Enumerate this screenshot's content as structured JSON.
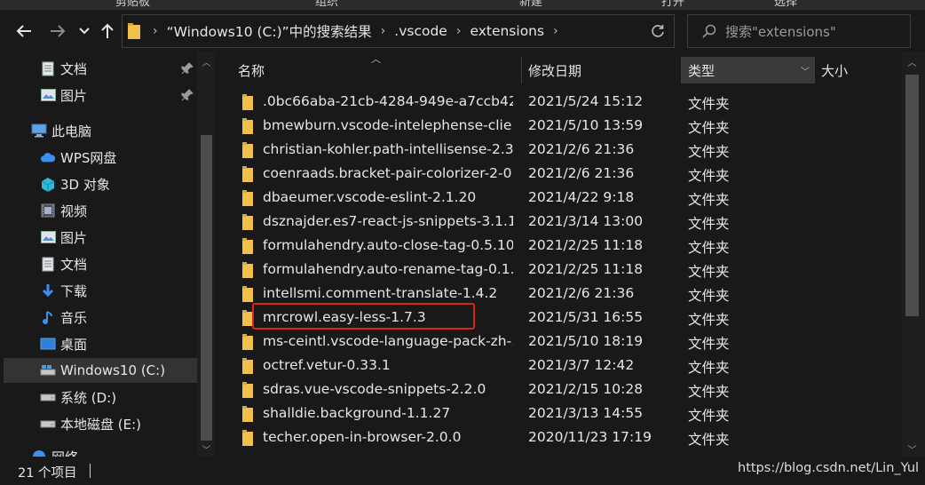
{
  "ribbon": {
    "labels": [
      "剪贴板",
      "组织",
      "新建",
      "打开",
      "选择"
    ]
  },
  "address": {
    "crumbs": [
      "“Windows10 (C:)”中的搜索结果",
      ".vscode",
      "extensions"
    ]
  },
  "search": {
    "placeholder": "搜索\"extensions\""
  },
  "nav": {
    "items": [
      {
        "label": "文档",
        "icon": "document-icon",
        "pinned": true
      },
      {
        "label": "图片",
        "icon": "picture-icon",
        "pinned": true
      },
      {
        "label": "此电脑",
        "icon": "computer-icon"
      },
      {
        "label": "WPS网盘",
        "icon": "cloud-icon"
      },
      {
        "label": "3D 对象",
        "icon": "3d-object-icon"
      },
      {
        "label": "视频",
        "icon": "video-icon"
      },
      {
        "label": "图片",
        "icon": "picture-icon"
      },
      {
        "label": "文档",
        "icon": "document-icon"
      },
      {
        "label": "下载",
        "icon": "download-icon"
      },
      {
        "label": "音乐",
        "icon": "music-icon"
      },
      {
        "label": "桌面",
        "icon": "desktop-icon"
      },
      {
        "label": "Windows10 (C:)",
        "icon": "drive-icon",
        "selected": true
      },
      {
        "label": "系统 (D:)",
        "icon": "drive-icon"
      },
      {
        "label": "本地磁盘 (E:)",
        "icon": "drive-icon"
      },
      {
        "label": "网络",
        "icon": "network-icon"
      }
    ]
  },
  "columns": {
    "name": "名称",
    "date": "修改日期",
    "type": "类型",
    "size": "大小"
  },
  "files": [
    {
      "name": ".0bc66aba-21cb-4284-949e-a7ccb42...",
      "date": "2021/5/24 15:12",
      "type": "文件夹"
    },
    {
      "name": "bmewburn.vscode-intelephense-clie...",
      "date": "2021/5/10 13:59",
      "type": "文件夹"
    },
    {
      "name": "christian-kohler.path-intellisense-2.3.0",
      "date": "2021/2/6 21:36",
      "type": "文件夹"
    },
    {
      "name": "coenraads.bracket-pair-colorizer-2-0...",
      "date": "2021/2/6 21:36",
      "type": "文件夹"
    },
    {
      "name": "dbaeumer.vscode-eslint-2.1.20",
      "date": "2021/4/22 9:18",
      "type": "文件夹"
    },
    {
      "name": "dsznajder.es7-react-js-snippets-3.1.1",
      "date": "2021/3/14 13:00",
      "type": "文件夹"
    },
    {
      "name": "formulahendry.auto-close-tag-0.5.10",
      "date": "2021/2/25 11:18",
      "type": "文件夹"
    },
    {
      "name": "formulahendry.auto-rename-tag-0.1.6",
      "date": "2021/2/25 11:18",
      "type": "文件夹"
    },
    {
      "name": "intellsmi.comment-translate-1.4.2",
      "date": "2021/2/6 21:36",
      "type": "文件夹"
    },
    {
      "name": "mrcrowl.easy-less-1.7.3",
      "date": "2021/5/31 16:55",
      "type": "文件夹"
    },
    {
      "name": "ms-ceintl.vscode-language-pack-zh-...",
      "date": "2021/5/10 18:19",
      "type": "文件夹"
    },
    {
      "name": "octref.vetur-0.33.1",
      "date": "2021/3/7 12:42",
      "type": "文件夹"
    },
    {
      "name": "sdras.vue-vscode-snippets-2.2.0",
      "date": "2021/2/15 10:28",
      "type": "文件夹"
    },
    {
      "name": "shalldie.background-1.1.27",
      "date": "2021/3/13 14:55",
      "type": "文件夹"
    },
    {
      "name": "techer.open-in-browser-2.0.0",
      "date": "2020/11/23 17:19",
      "type": "文件夹"
    }
  ],
  "status": {
    "count": "21 个项目"
  },
  "watermark": "https://blog.csdn.net/Lin_Yul",
  "colors": {
    "background": "#191919",
    "folder": "#f0c04a",
    "highlight_box": "#e02020"
  }
}
